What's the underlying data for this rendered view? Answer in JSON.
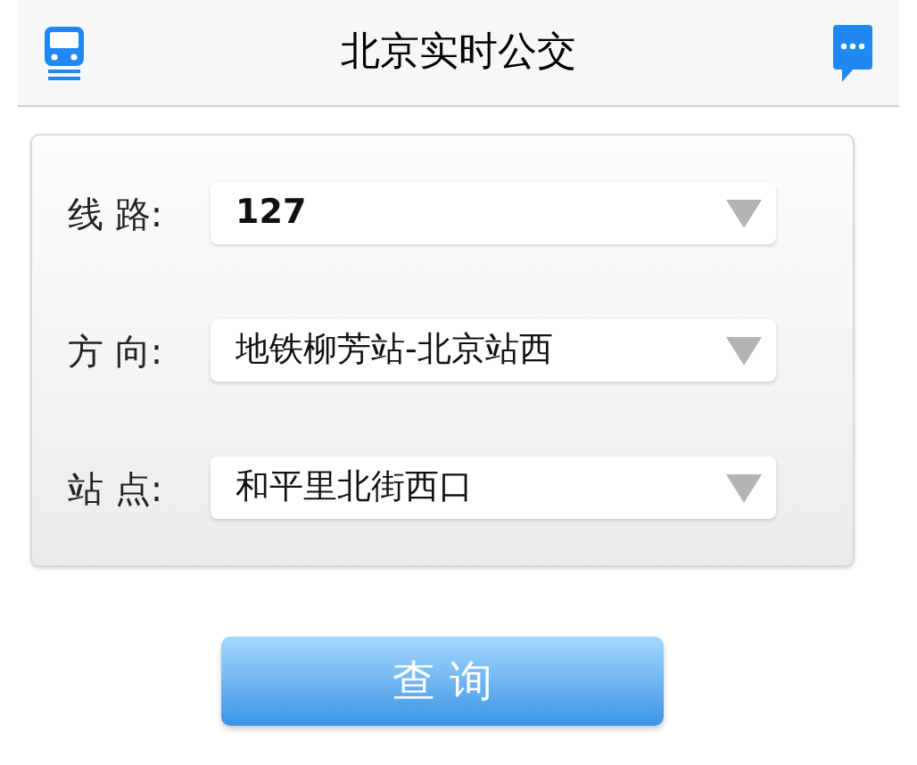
{
  "header": {
    "title": "北京实时公交"
  },
  "form": {
    "fields": [
      {
        "label": "线 路:",
        "value": "127",
        "bold": true
      },
      {
        "label": "方 向:",
        "value": "地铁柳芳站-北京站西",
        "bold": false
      },
      {
        "label": "站 点:",
        "value": "和平里北街西口",
        "bold": false
      }
    ]
  },
  "button": {
    "label": "查 询"
  }
}
